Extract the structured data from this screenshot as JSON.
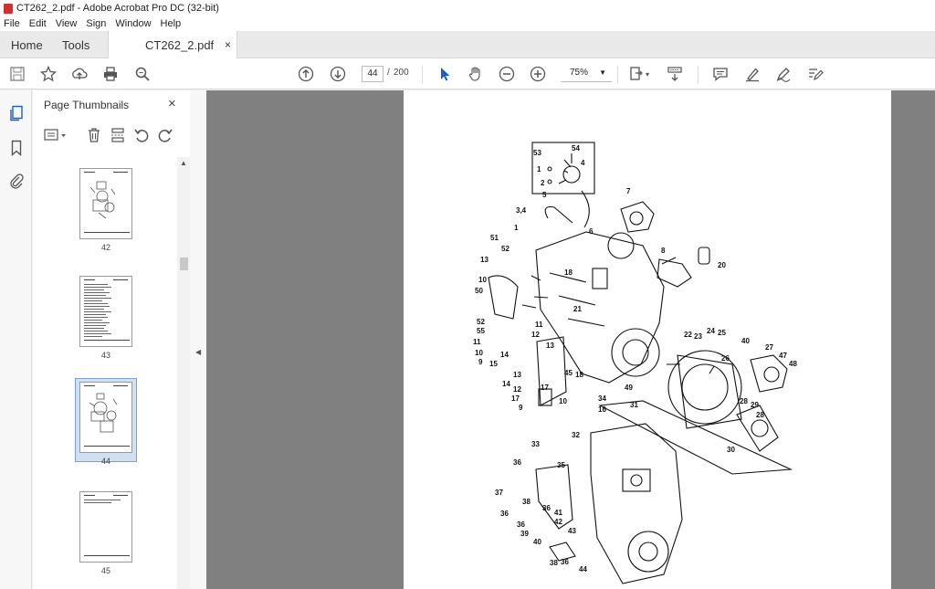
{
  "window": {
    "title": "CT262_2.pdf - Adobe Acrobat Pro DC (32-bit)"
  },
  "menu": [
    "File",
    "Edit",
    "View",
    "Sign",
    "Window",
    "Help"
  ],
  "tabs": {
    "home": "Home",
    "tools": "Tools",
    "doc": "CT262_2.pdf",
    "close": "×"
  },
  "toolbar": {
    "page_current": "44",
    "page_sep": "/",
    "page_total": "200",
    "zoom": "75%"
  },
  "panel": {
    "title": "Page Thumbnails",
    "close": "×"
  },
  "thumbnails": [
    {
      "label": "42"
    },
    {
      "label": "43"
    },
    {
      "label": "44"
    },
    {
      "label": "45"
    }
  ],
  "diagram": {
    "labels": [
      "53",
      "54",
      "1",
      "4",
      "2",
      "5",
      "3,4",
      "7",
      "6",
      "1",
      "51",
      "52",
      "13",
      "8",
      "20",
      "18",
      "10",
      "50",
      "21",
      "52",
      "55",
      "11",
      "12",
      "13",
      "11",
      "10",
      "9",
      "14",
      "15",
      "13",
      "45",
      "18",
      "22",
      "23",
      "24",
      "25",
      "40",
      "27",
      "47",
      "48",
      "26",
      "14",
      "12",
      "17",
      "17",
      "10",
      "9",
      "49",
      "34",
      "16",
      "31",
      "28",
      "29",
      "28",
      "30",
      "32",
      "33",
      "36",
      "35",
      "37",
      "38",
      "36",
      "36",
      "36",
      "39",
      "40",
      "41",
      "42",
      "43",
      "38",
      "36",
      "44"
    ]
  }
}
